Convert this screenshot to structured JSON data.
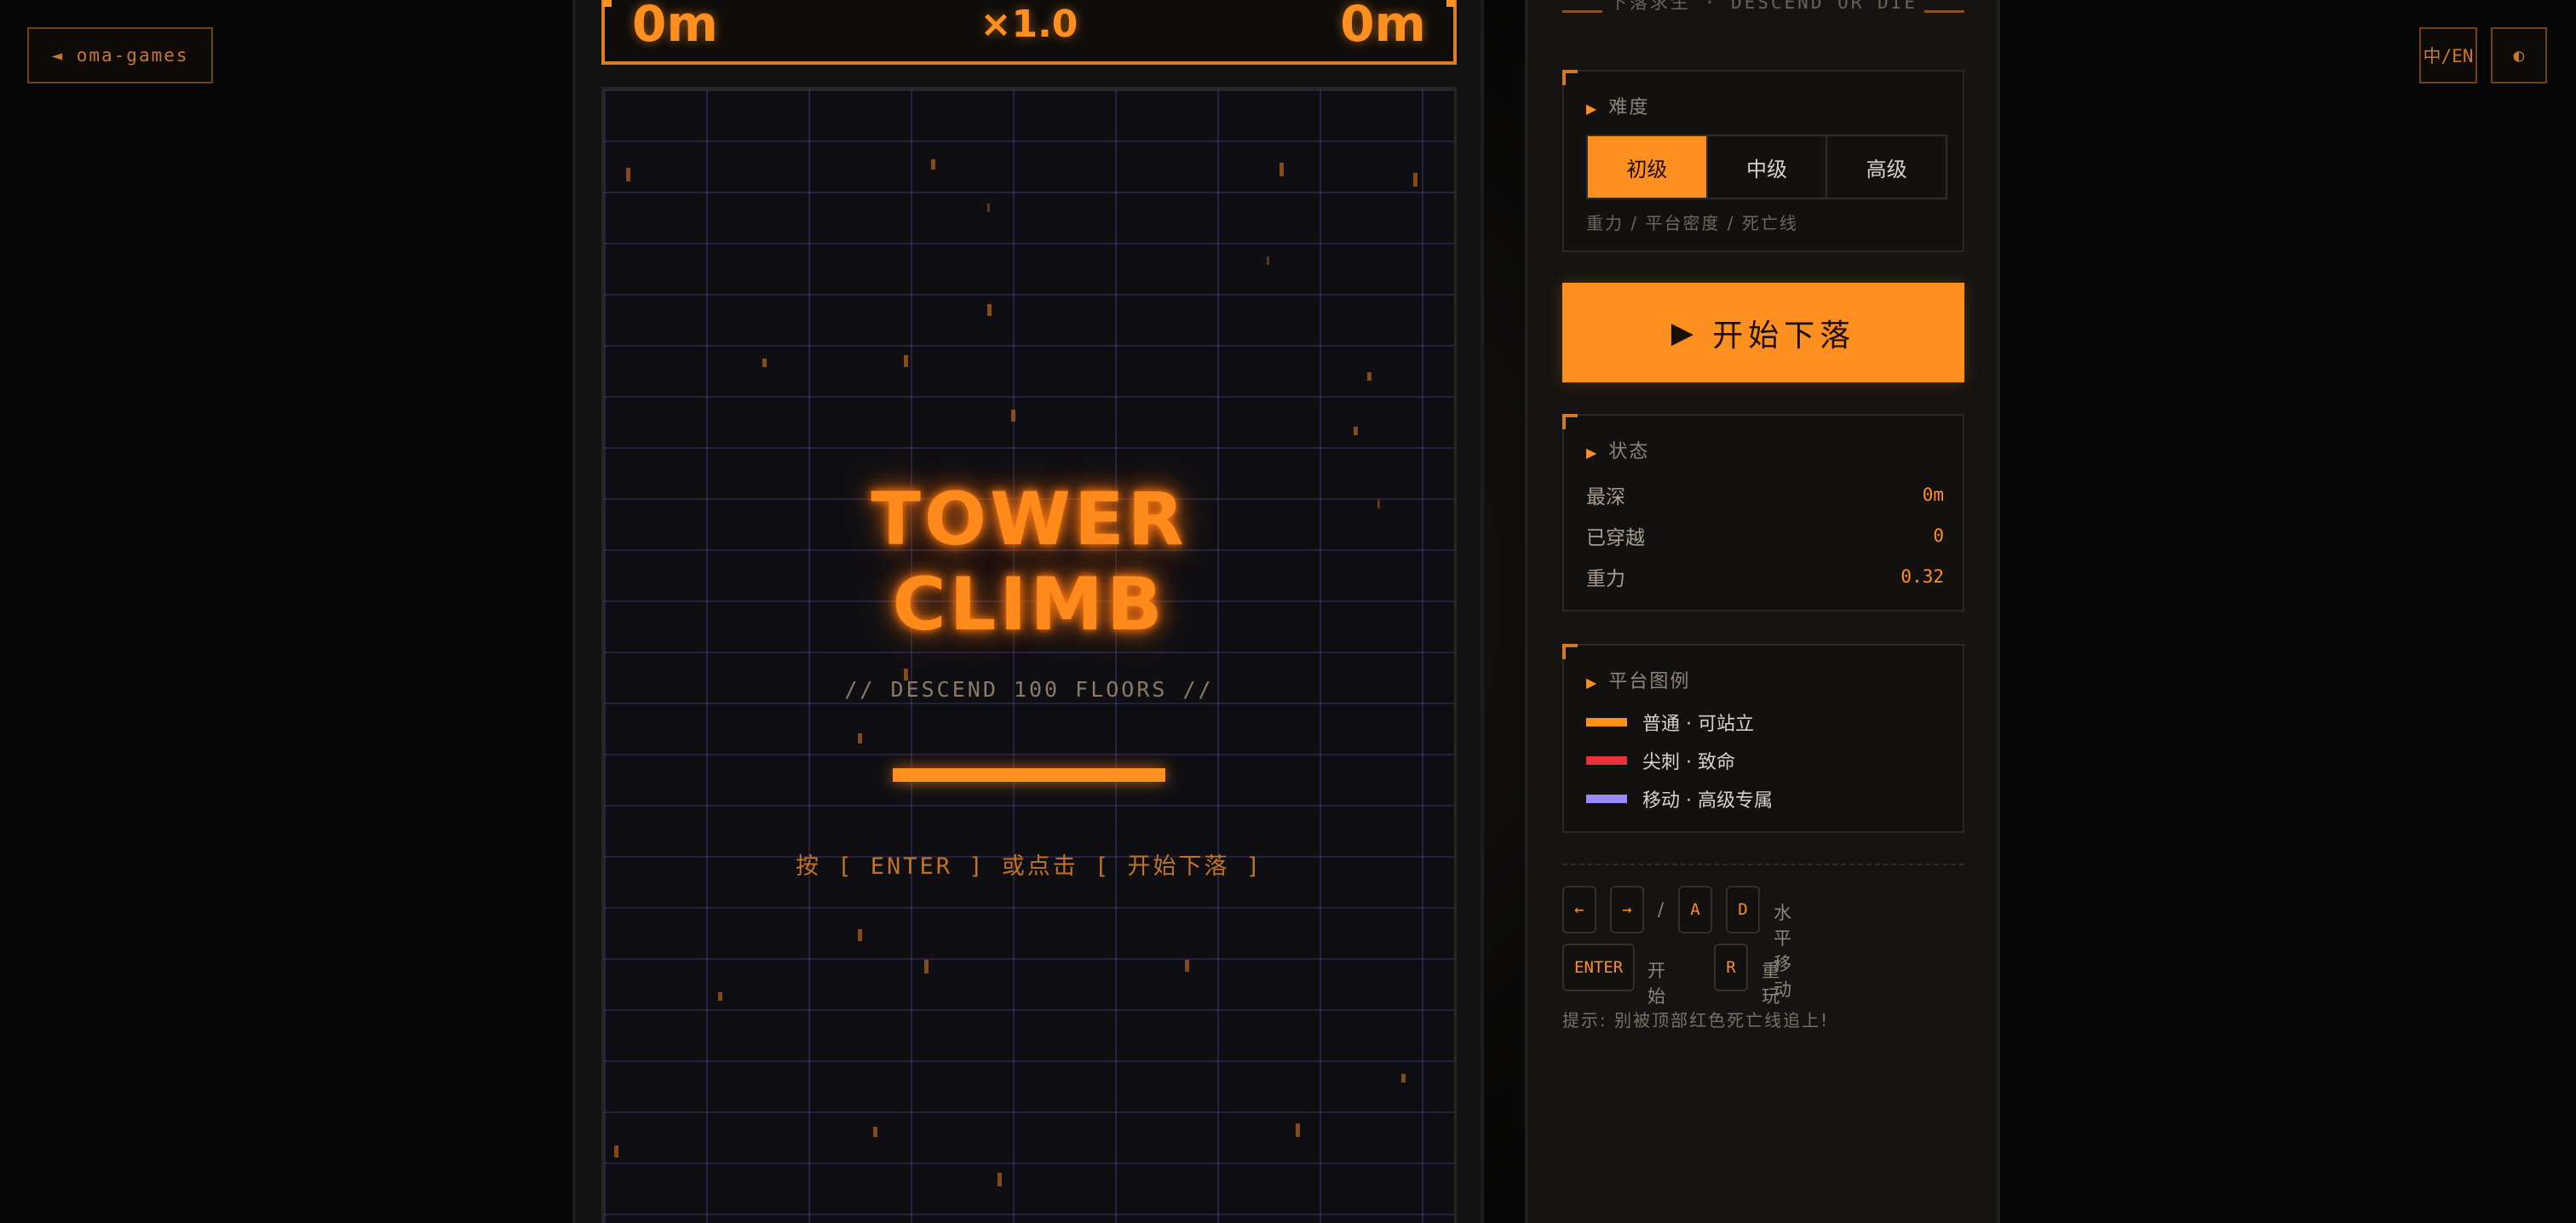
{
  "nav": {
    "back_label": "◄ oma-games",
    "lang_label": "中/EN",
    "theme_icon": "◐"
  },
  "hud": {
    "depth_left": "0m",
    "multiplier": "×1.0",
    "depth_right": "0m"
  },
  "splash": {
    "title_line1": "TOWER",
    "title_line2": "CLIMB",
    "subtitle": "// DESCEND 100 FLOORS //",
    "prompt": "按 [ ENTER ] 或点击 [ 开始下落 ]"
  },
  "side": {
    "header": "下落求生 · DESCEND OR DIE",
    "difficulty": {
      "title": "难度",
      "options": [
        "初级",
        "中级",
        "高级"
      ],
      "selected": "初级",
      "note": "重力 / 平台密度 / 死亡线"
    },
    "start_button": {
      "icon": "▶",
      "label": "开始下落"
    },
    "status": {
      "title": "状态",
      "rows": [
        {
          "label": "最深",
          "value": "0m"
        },
        {
          "label": "已穿越",
          "value": "0"
        },
        {
          "label": "重力",
          "value": "0.32"
        }
      ]
    },
    "legend": {
      "title": "平台图例",
      "items": [
        {
          "label": "普通 · 可站立",
          "color": "#ff8f1f"
        },
        {
          "label": "尖刺 · 致命",
          "color": "#e8323a"
        },
        {
          "label": "移动 · 高级专属",
          "color": "#9a8cff"
        }
      ]
    },
    "controls": {
      "keys_move": [
        "←",
        "→",
        "/",
        "A",
        "D"
      ],
      "move_label": "水平移动",
      "start_key": "ENTER",
      "start_label": "开始",
      "restart_key": "R",
      "restart_label": "重玩"
    },
    "hint": "提示: 别被顶部红色死亡线追上!"
  },
  "colors": {
    "accent": "#ff8f1f",
    "spike": "#e8323a",
    "moving": "#9a8cff",
    "background": "#050505"
  }
}
